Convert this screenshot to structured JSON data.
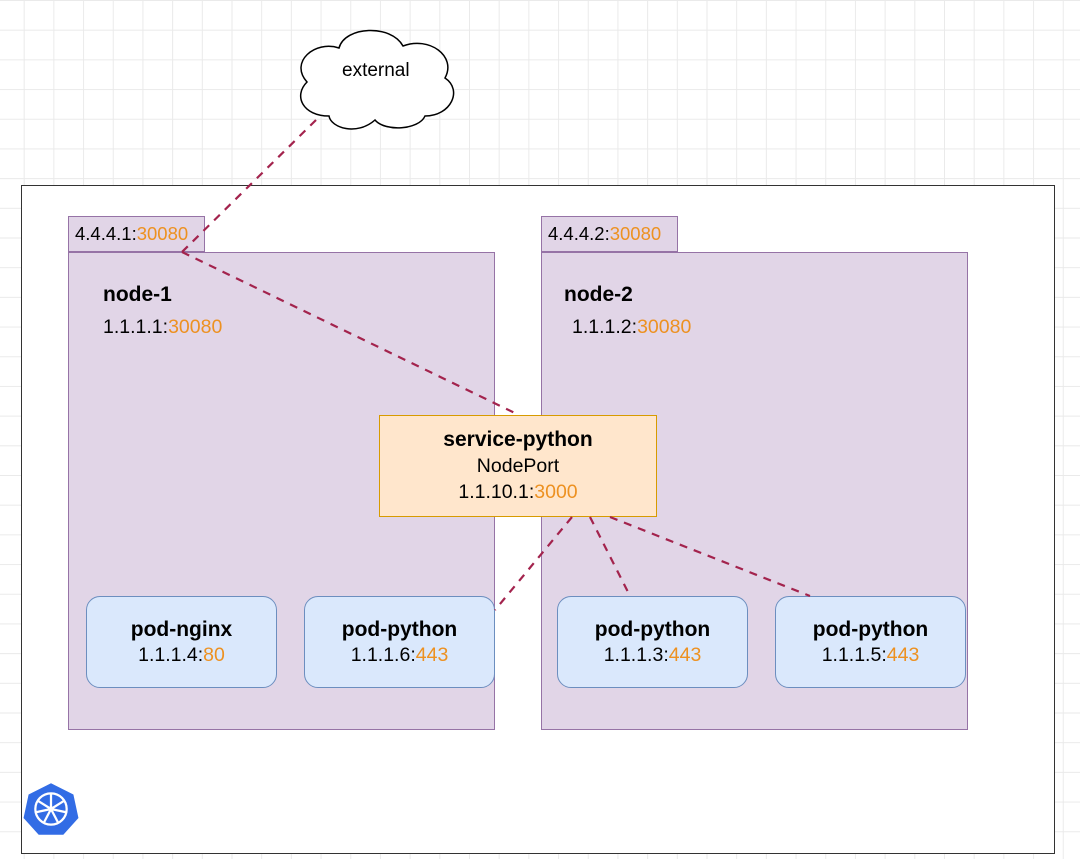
{
  "external": {
    "label": "external"
  },
  "nodes": [
    {
      "tab_ip": "4.4.4.1:",
      "tab_port": "30080",
      "name": "node-1",
      "ip": "1.1.1.1:",
      "port": "30080"
    },
    {
      "tab_ip": "4.4.4.2:",
      "tab_port": "30080",
      "name": "node-2",
      "ip": "1.1.1.2:",
      "port": "30080"
    }
  ],
  "service": {
    "name": "service-python",
    "type": "NodePort",
    "ip": "1.1.10.1:",
    "port": "3000"
  },
  "pods": [
    {
      "name": "pod-nginx",
      "ip": "1.1.1.4:",
      "port": "80"
    },
    {
      "name": "pod-python",
      "ip": "1.1.1.6:",
      "port": "443"
    },
    {
      "name": "pod-python",
      "ip": "1.1.1.3:",
      "port": "443"
    },
    {
      "name": "pod-python",
      "ip": "1.1.1.5:",
      "port": "443"
    }
  ],
  "colors": {
    "node_fill": "#e1d5e7",
    "node_stroke": "#9673a6",
    "service_fill": "#ffe6cc",
    "service_stroke": "#d79b00",
    "pod_fill": "#dae8fc",
    "pod_stroke": "#6c8ebf",
    "connector": "#a3234d",
    "port_highlight": "#ed9121",
    "k8s_blue": "#326ce5"
  }
}
